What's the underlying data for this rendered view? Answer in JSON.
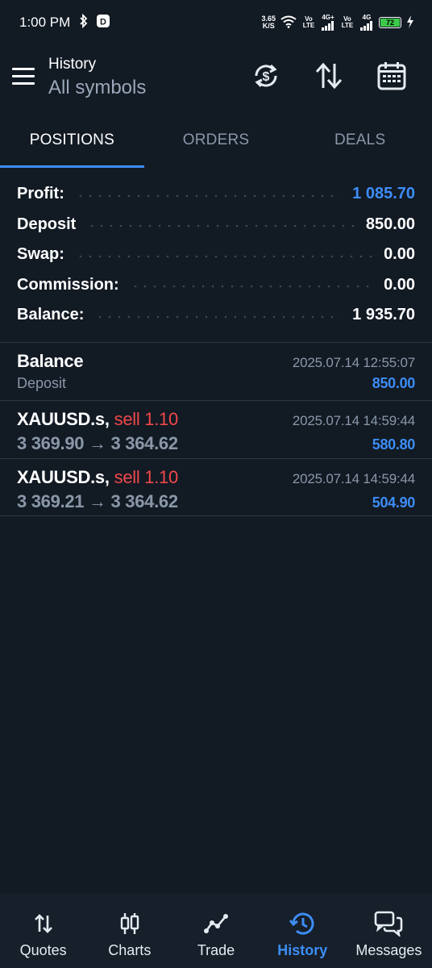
{
  "status_bar": {
    "time": "1:00 PM",
    "net_speed_value": "3.65",
    "net_speed_unit": "K/S",
    "sim1_label": "Vo LTE",
    "sim1_type": "4G+",
    "sim2_label": "Vo LTE",
    "sim2_type": "4G",
    "battery": "72"
  },
  "header": {
    "subtitle": "History",
    "title": "All symbols"
  },
  "tabs": [
    {
      "label": "POSITIONS",
      "active": true
    },
    {
      "label": "ORDERS",
      "active": false
    },
    {
      "label": "DEALS",
      "active": false
    }
  ],
  "summary": [
    {
      "label": "Profit:",
      "value": "1 085.70",
      "highlight": true
    },
    {
      "label": "Deposit",
      "value": "850.00",
      "highlight": false
    },
    {
      "label": "Swap:",
      "value": "0.00",
      "highlight": false
    },
    {
      "label": "Commission:",
      "value": "0.00",
      "highlight": false
    },
    {
      "label": "Balance:",
      "value": "1 935.70",
      "highlight": false
    }
  ],
  "history": [
    {
      "title": "Balance",
      "action": "",
      "date": "2025.07.14 12:55:07",
      "sub": "Deposit",
      "amount": "850.00"
    },
    {
      "title": "XAUUSD.s,",
      "action": "sell 1.10",
      "date": "2025.07.14 14:59:44",
      "sub": "3 369.90 → 3 364.62",
      "amount": "580.80"
    },
    {
      "title": "XAUUSD.s,",
      "action": "sell 1.10",
      "date": "2025.07.14 14:59:44",
      "sub": "3 369.21 → 3 364.62",
      "amount": "504.90"
    }
  ],
  "bottom_nav": [
    {
      "label": "Quotes",
      "icon": "quotes-icon",
      "active": false
    },
    {
      "label": "Charts",
      "icon": "charts-icon",
      "active": false
    },
    {
      "label": "Trade",
      "icon": "trade-icon",
      "active": false
    },
    {
      "label": "History",
      "icon": "history-icon",
      "active": true
    },
    {
      "label": "Messages",
      "icon": "messages-icon",
      "active": false
    }
  ],
  "colors": {
    "background": "#121a24",
    "accent": "#3d8df5",
    "sell": "#f0484b",
    "muted": "#8a97a8"
  }
}
